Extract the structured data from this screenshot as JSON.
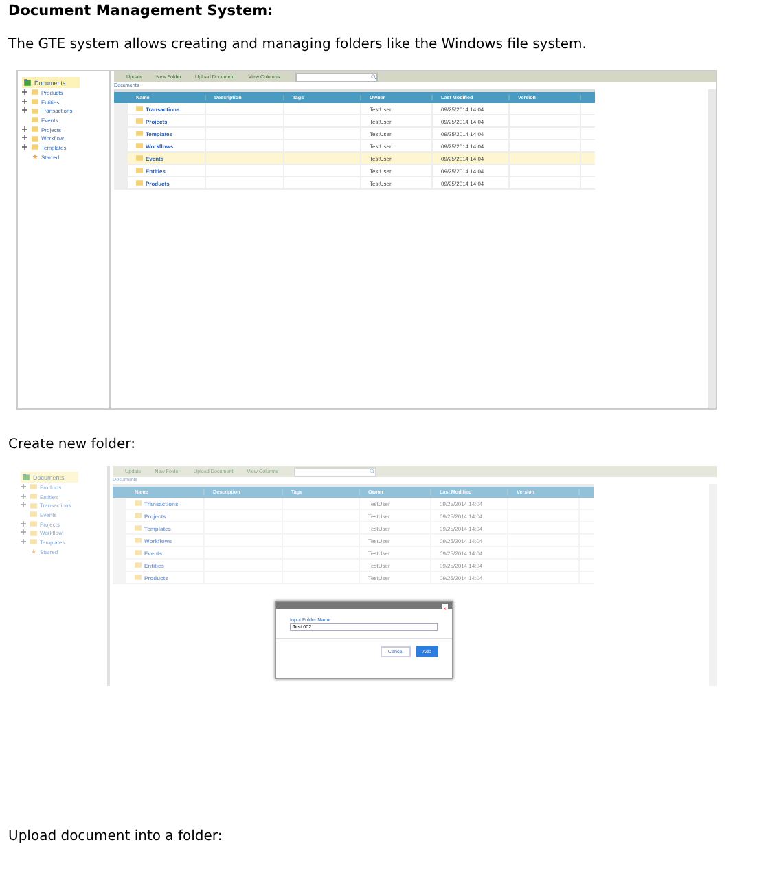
{
  "title": "Document Management System:",
  "intro": "The GTE system allows creating and managing folders like the Windows file system.",
  "sections": [
    {
      "screen": {
        "dimmed": false,
        "root": "Documents",
        "tree": [
          {
            "label": "Products",
            "kind": "folder",
            "expandable": true
          },
          {
            "label": "Entities",
            "kind": "folder",
            "expandable": true
          },
          {
            "label": "Transactions",
            "kind": "folder",
            "expandable": true
          },
          {
            "label": "Events",
            "kind": "folder",
            "expandable": false
          },
          {
            "label": "Projects",
            "kind": "folder",
            "expandable": true
          },
          {
            "label": "Workflow",
            "kind": "folder",
            "expandable": true
          },
          {
            "label": "Templates",
            "kind": "folder",
            "expandable": true
          },
          {
            "label": "Starred",
            "kind": "starred",
            "expandable": false
          }
        ],
        "toolbar": [
          "Update",
          "New Folder",
          "Upload Document",
          "View Columns"
        ],
        "breadcrumb": "Documents",
        "columns": [
          "Name",
          "Description",
          "Tags",
          "Owner",
          "Last Modified",
          "Version"
        ],
        "rows": [
          {
            "name": "Transactions",
            "owner": "TestUser",
            "modified": "09/25/2014 14:04",
            "selected": false
          },
          {
            "name": "Projects",
            "owner": "TestUser",
            "modified": "09/25/2014 14:04",
            "selected": false
          },
          {
            "name": "Templates",
            "owner": "TestUser",
            "modified": "09/25/2014 14:04",
            "selected": false
          },
          {
            "name": "Workflows",
            "owner": "TestUser",
            "modified": "09/25/2014 14:04",
            "selected": false
          },
          {
            "name": "Events",
            "owner": "TestUser",
            "modified": "09/25/2014 14:04",
            "selected": true
          },
          {
            "name": "Entities",
            "owner": "TestUser",
            "modified": "09/25/2014 14:04",
            "selected": false
          },
          {
            "name": "Products",
            "owner": "TestUser",
            "modified": "09/25/2014 14:04",
            "selected": false
          }
        ]
      }
    },
    {
      "caption": "Create new folder:",
      "screen": {
        "dimmed": true,
        "root": "Documents",
        "tree": [
          {
            "label": "Products",
            "kind": "folder",
            "expandable": true
          },
          {
            "label": "Entities",
            "kind": "folder",
            "expandable": true
          },
          {
            "label": "Transactions",
            "kind": "folder",
            "expandable": true
          },
          {
            "label": "Events",
            "kind": "folder",
            "expandable": false
          },
          {
            "label": "Projects",
            "kind": "folder",
            "expandable": true
          },
          {
            "label": "Workflow",
            "kind": "folder",
            "expandable": true
          },
          {
            "label": "Templates",
            "kind": "folder",
            "expandable": true
          },
          {
            "label": "Starred",
            "kind": "starred",
            "expandable": false
          }
        ],
        "toolbar": [
          "Update",
          "New Folder",
          "Upload Document",
          "View Columns"
        ],
        "breadcrumb": "Documents",
        "columns": [
          "Name",
          "Description",
          "Tags",
          "Owner",
          "Last Modified",
          "Version"
        ],
        "rows": [
          {
            "name": "Transactions",
            "owner": "TestUser",
            "modified": "09/25/2014 14:04",
            "selected": false
          },
          {
            "name": "Projects",
            "owner": "TestUser",
            "modified": "09/25/2014 14:04",
            "selected": false
          },
          {
            "name": "Templates",
            "owner": "TestUser",
            "modified": "09/25/2014 14:04",
            "selected": false
          },
          {
            "name": "Workflows",
            "owner": "TestUser",
            "modified": "09/25/2014 14:04",
            "selected": false
          },
          {
            "name": "Events",
            "owner": "TestUser",
            "modified": "09/25/2014 14:04",
            "selected": false
          },
          {
            "name": "Entities",
            "owner": "TestUser",
            "modified": "09/25/2014 14:04",
            "selected": false
          },
          {
            "name": "Products",
            "owner": "TestUser",
            "modified": "09/25/2014 14:04",
            "selected": false
          }
        ],
        "dialog": {
          "label": "Input Folder Name",
          "value": "Test 002",
          "close": "×",
          "buttons": [
            {
              "label": "Cancel",
              "kind": "secondary"
            },
            {
              "label": "Add",
              "kind": "primary"
            }
          ]
        }
      }
    }
  ],
  "footer": "Upload document into a folder:"
}
